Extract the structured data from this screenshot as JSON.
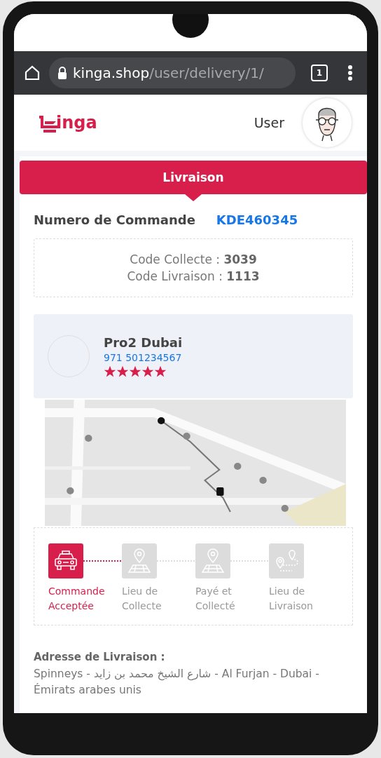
{
  "browser": {
    "url_host": "kinga.shop",
    "url_path": "/user/delivery/1/",
    "tab_count": "1"
  },
  "header": {
    "logo_text": "inga",
    "user_label": "User"
  },
  "banner": {
    "title": "Livraison"
  },
  "order": {
    "label": "Numero de Commande",
    "number": "KDE460345"
  },
  "codes": [
    "Code Collecte : **3039**",
    "Code Livraison : **1113**"
  ],
  "provider": {
    "name": "Pro2 Dubai",
    "phone": "971 501234567",
    "stars": 5
  },
  "steps": [
    {
      "kind": "car",
      "lines": [
        "Commande",
        "Acceptée"
      ],
      "active": true
    },
    {
      "kind": "map",
      "lines": [
        "Lieu de",
        "Collecte"
      ],
      "active": false
    },
    {
      "kind": "map",
      "lines": [
        "Payé et",
        "Collecté"
      ],
      "active": false
    },
    {
      "kind": "route",
      "lines": [
        "Lieu de",
        "Livraison"
      ],
      "active": false
    }
  ],
  "address": {
    "label": "Adresse de Livraison :",
    "text": "Spinneys - شارع الشيخ محمد بن زايد - Al Furjan - Dubai - Émirats arabes unis"
  }
}
